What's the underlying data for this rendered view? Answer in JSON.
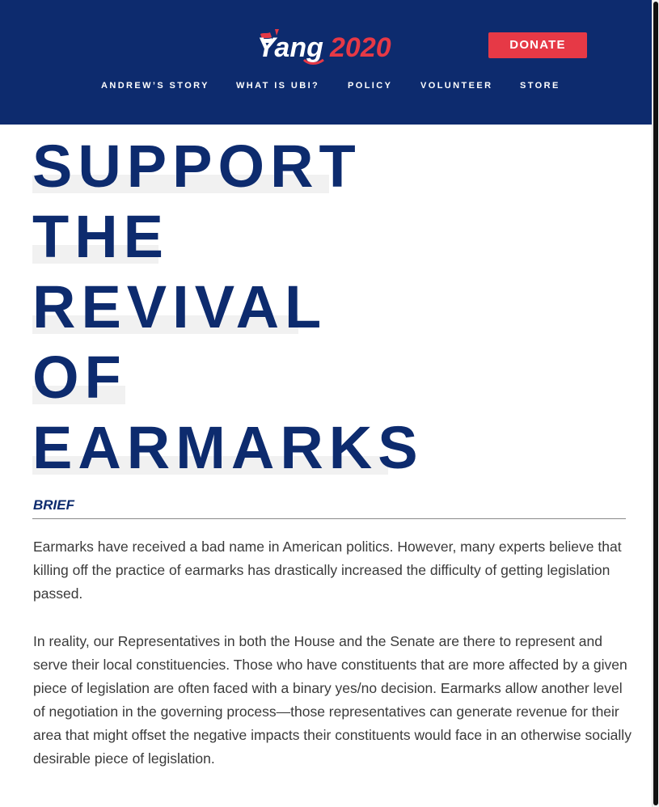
{
  "header": {
    "logo": {
      "text_main": "Yang",
      "text_year": "2020",
      "icon": "flag-y-icon"
    },
    "donate_label": "DONATE",
    "nav": [
      {
        "label": "ANDREW’S STORY"
      },
      {
        "label": "WHAT IS UBI?"
      },
      {
        "label": "POLICY"
      },
      {
        "label": "VOLUNTEER"
      },
      {
        "label": "STORE"
      }
    ]
  },
  "article": {
    "title_lines": [
      "SUPPORT",
      "THE",
      "REVIVAL",
      "OF",
      "EARMARKS"
    ],
    "brief_label": "BRIEF",
    "paragraphs": [
      "Earmarks have received a bad name in American politics. However, many experts believe that killing off the practice of earmarks has drastically increased the difficulty of getting legislation passed.",
      "In reality, our Representatives in both the House and the Senate are there to represent and serve their local constituencies. Those who have constituents that are more affected by a given piece of legislation are often faced with a binary yes/no decision. Earmarks allow another level of negotiation in the governing process—those representatives can generate revenue for their area that might offset the negative impacts their constituents would face in an otherwise socially desirable piece of legislation."
    ]
  },
  "colors": {
    "navy": "#0d2b6e",
    "accent_red": "#e63946",
    "highlight": "#f1f1f1",
    "body_text": "#3a3a3a"
  }
}
